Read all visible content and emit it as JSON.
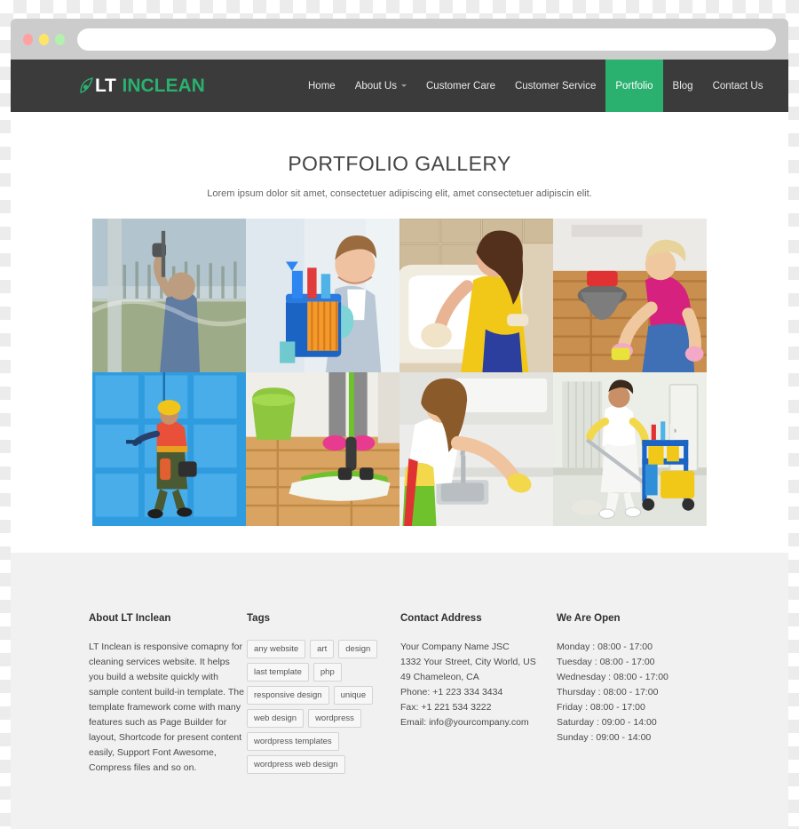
{
  "browser": {
    "url_value": "",
    "url_placeholder": "",
    "dots": [
      "close-red",
      "minimize-yellow",
      "maximize-green"
    ]
  },
  "header": {
    "logo": {
      "icon": "leaf-swoosh-icon",
      "primary": "LT",
      "secondary": "INCLEAN"
    },
    "nav": [
      {
        "label": "Home",
        "active": false,
        "has_caret": false
      },
      {
        "label": "About Us",
        "active": false,
        "has_caret": true
      },
      {
        "label": "Customer Care",
        "active": false,
        "has_caret": false
      },
      {
        "label": "Customer Service",
        "active": false,
        "has_caret": false
      },
      {
        "label": "Portfolio",
        "active": true,
        "has_caret": false
      },
      {
        "label": "Blog",
        "active": false,
        "has_caret": false
      },
      {
        "label": "Contact Us",
        "active": false,
        "has_caret": false
      }
    ],
    "accent_color": "#2ab06f",
    "bar_color": "#3b3b3b"
  },
  "main": {
    "title": "PORTFOLIO GALLERY",
    "subtitle": "Lorem ipsum dolor sit amet, consectetuer adipiscing elit, amet consectetuer adipiscin elit.",
    "gallery": [
      {
        "name": "window-cleaner-squeegee",
        "alt": "Man cleaning a large window with a squeegee outdoors"
      },
      {
        "name": "maid-with-bucket",
        "alt": "Smiling woman in blue uniform holding blue bucket with cleaning supplies and orange cloth"
      },
      {
        "name": "bathtub-cleaning",
        "alt": "Woman in yellow shirt scrubbing a bathtub"
      },
      {
        "name": "floor-scrubbing",
        "alt": "Blonde woman in pink top scrubbing a wooden floor with a sponge"
      },
      {
        "name": "rope-access-window-washer",
        "alt": "Rope access worker cleaning blue glass facade of a high-rise"
      },
      {
        "name": "mopping-wood-floor",
        "alt": "Person in pink slippers mopping a wooden floor with a green flat mop"
      },
      {
        "name": "kitchen-counter-cleaning",
        "alt": "Woman wiping kitchen counter next to the sink wearing yellow gloves"
      },
      {
        "name": "janitor-with-cart",
        "alt": "Male janitor mopping hallway beside a blue cleaning cart with yellow buckets"
      }
    ]
  },
  "footer": {
    "about": {
      "heading": "About LT Inclean",
      "text": "LT Inclean is responsive comapny for cleaning services website. It helps you build a website quickly with sample content build-in template. The template framework come with many features such as Page Builder for layout, Shortcode for present content easily, Support Font Awesome, Compress files and so on."
    },
    "tags": {
      "heading": "Tags",
      "items": [
        "any website",
        "art",
        "design",
        "last template",
        "php",
        "responsive design",
        "unique",
        "web design",
        "wordpress",
        "wordpress templates",
        "wordpress web design"
      ]
    },
    "contact": {
      "heading": "Contact Address",
      "lines": [
        "Your Company Name JSC",
        "1332 Your Street, City World, US",
        "49 Chameleon, CA",
        "Phone: +1 223 334 3434",
        "Fax: +1 221 534 3222",
        "Email: info@yourcompany.com"
      ]
    },
    "hours": {
      "heading": "We Are Open",
      "lines": [
        "Monday : 08:00 - 17:00",
        "Tuesday : 08:00 - 17:00",
        "Wednesday : 08:00 - 17:00",
        "Thursday : 08:00 - 17:00",
        "Friday : 08:00 - 17:00",
        "Saturday : 09:00 - 14:00",
        "Sunday : 09:00 - 14:00"
      ]
    }
  }
}
